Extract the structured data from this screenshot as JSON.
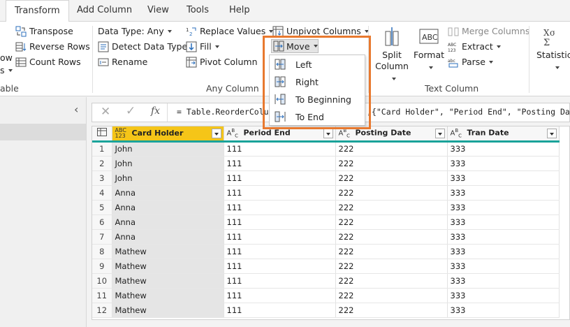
{
  "tabs": [
    "Transform",
    "Add Column",
    "View",
    "Tools",
    "Help"
  ],
  "ribbon": {
    "left_cut": {
      "line1": "ow",
      "line2": "s",
      "group_label": "able"
    },
    "table_group": {
      "transpose": "Transpose",
      "reverse_rows": "Reverse Rows",
      "count_rows": "Count Rows"
    },
    "any_column": {
      "data_type": "Data Type: Any",
      "detect_type": "Detect Data Type",
      "rename": "Rename",
      "replace_values": "Replace Values",
      "fill": "Fill",
      "pivot": "Pivot Column",
      "unpivot": "Unpivot Columns",
      "move": "Move",
      "group_label": "Any Column"
    },
    "text_column": {
      "split_line1": "Split",
      "split_line2": "Column",
      "format": "Format",
      "merge": "Merge Columns",
      "extract": "Extract",
      "parse": "Parse",
      "group_label": "Text Column"
    },
    "statistics": "Statistics"
  },
  "move_menu": [
    "Left",
    "Right",
    "To Beginning",
    "To End"
  ],
  "formula_bar": {
    "prefix": "= Table.ReorderColum",
    "suffix": ",{\"Card Holder\", \"Period End\", \"Posting Date\""
  },
  "columns": [
    {
      "name": "Card Holder",
      "type": "ABC/123"
    },
    {
      "name": "Period End",
      "type": "ABC"
    },
    {
      "name": "Posting Date",
      "type": "ABC"
    },
    {
      "name": "Tran Date",
      "type": "ABC"
    }
  ],
  "rows": [
    [
      "1",
      "John",
      "111",
      "222",
      "333"
    ],
    [
      "2",
      "John",
      "111",
      "222",
      "333"
    ],
    [
      "3",
      "John",
      "111",
      "222",
      "333"
    ],
    [
      "4",
      "Anna",
      "111",
      "222",
      "333"
    ],
    [
      "5",
      "Anna",
      "111",
      "222",
      "333"
    ],
    [
      "6",
      "Anna",
      "111",
      "222",
      "333"
    ],
    [
      "7",
      "Anna",
      "111",
      "222",
      "333"
    ],
    [
      "8",
      "Mathew",
      "111",
      "222",
      "333"
    ],
    [
      "9",
      "Mathew",
      "111",
      "222",
      "333"
    ],
    [
      "10",
      "Mathew",
      "111",
      "222",
      "333"
    ],
    [
      "11",
      "Mathew",
      "111",
      "222",
      "333"
    ],
    [
      "12",
      "Mathew",
      "111",
      "222",
      "333"
    ]
  ],
  "colors": {
    "selected_header": "#f5c518",
    "accent_line": "#1aa39a",
    "callout": "#e8792f"
  }
}
